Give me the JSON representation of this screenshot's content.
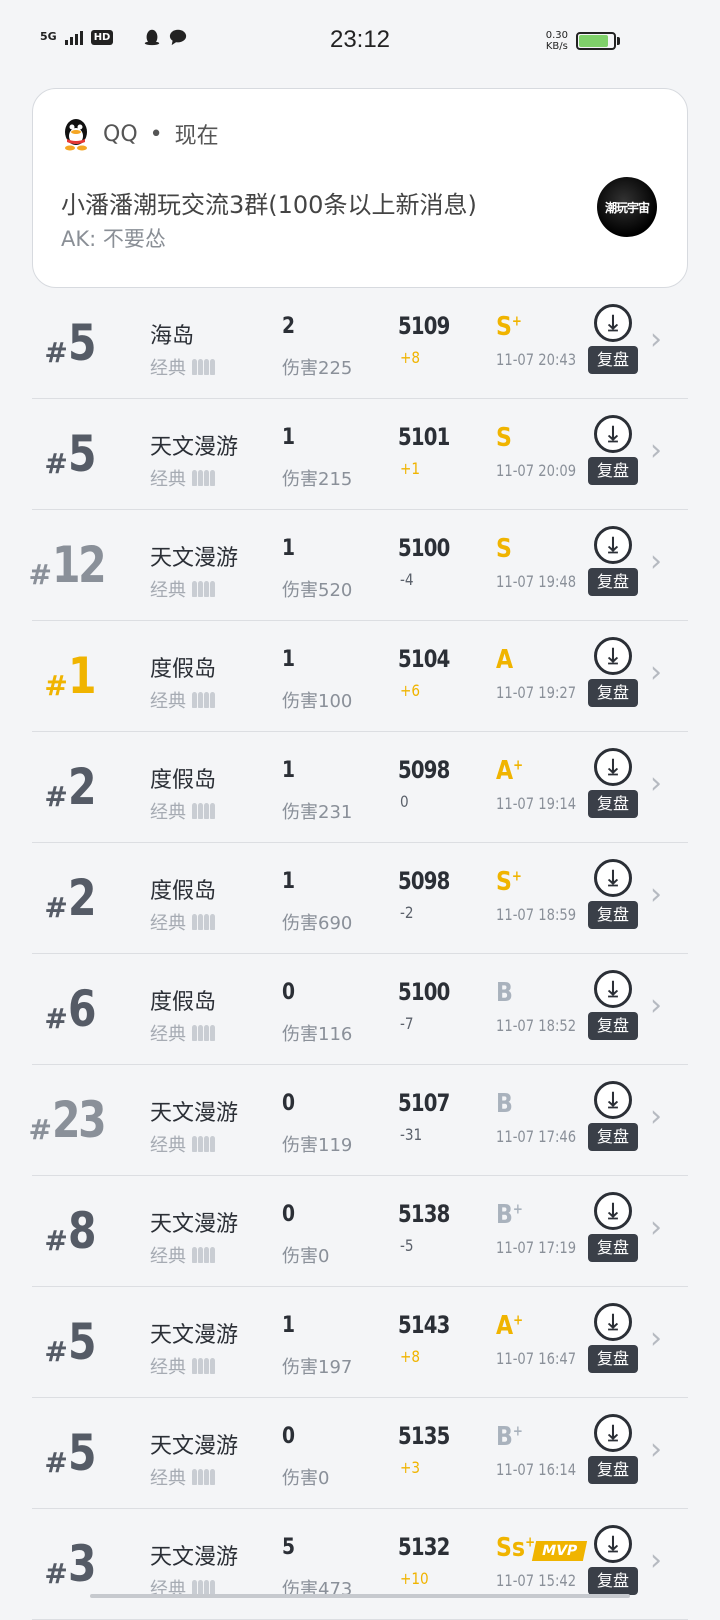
{
  "status_bar": {
    "network": "5G",
    "hd": "HD",
    "time": "23:12",
    "speed_value": "0.30",
    "speed_unit": "KB/s",
    "battery_percent": 85
  },
  "notification": {
    "app_name": "QQ",
    "separator": "•",
    "when": "现在",
    "title": "小潘潘潮玩交流3群(100条以上新消息)",
    "message": "AK: 不要怂",
    "avatar_text": "潮玩宇宙"
  },
  "colors": {
    "gold": "#f0b400",
    "dark": "#2b2f36",
    "gray": "#a9b2bd"
  },
  "replay_label": "复盘",
  "matches": [
    {
      "rank_hash": "#",
      "rank": "5",
      "rank_style": "normal",
      "map": "海岛",
      "mode": "经典",
      "kills": "2",
      "damage": "伤害225",
      "score": "5109",
      "delta": "+8",
      "delta_style": "pos",
      "grade": "S",
      "grade_sup": "+",
      "grade_style": "gold",
      "date": "11-07 20:43",
      "mvp": ""
    },
    {
      "rank_hash": "#",
      "rank": "5",
      "rank_style": "normal",
      "map": "天文漫游",
      "mode": "经典",
      "kills": "1",
      "damage": "伤害215",
      "score": "5101",
      "delta": "+1",
      "delta_style": "pos",
      "grade": "S",
      "grade_sup": "",
      "grade_style": "gold",
      "date": "11-07 20:09",
      "mvp": ""
    },
    {
      "rank_hash": "#",
      "rank": "12",
      "rank_style": "light",
      "map": "天文漫游",
      "mode": "经典",
      "kills": "1",
      "damage": "伤害520",
      "score": "5100",
      "delta": "-4",
      "delta_style": "neg",
      "grade": "S",
      "grade_sup": "",
      "grade_style": "gold",
      "date": "11-07 19:48",
      "mvp": ""
    },
    {
      "rank_hash": "#",
      "rank": "1",
      "rank_style": "gold",
      "map": "度假岛",
      "mode": "经典",
      "kills": "1",
      "damage": "伤害100",
      "score": "5104",
      "delta": "+6",
      "delta_style": "pos",
      "grade": "A",
      "grade_sup": "",
      "grade_style": "gold",
      "date": "11-07 19:27",
      "mvp": ""
    },
    {
      "rank_hash": "#",
      "rank": "2",
      "rank_style": "normal",
      "map": "度假岛",
      "mode": "经典",
      "kills": "1",
      "damage": "伤害231",
      "score": "5098",
      "delta": "0",
      "delta_style": "neg",
      "grade": "A",
      "grade_sup": "+",
      "grade_style": "gold",
      "date": "11-07 19:14",
      "mvp": ""
    },
    {
      "rank_hash": "#",
      "rank": "2",
      "rank_style": "normal",
      "map": "度假岛",
      "mode": "经典",
      "kills": "1",
      "damage": "伤害690",
      "score": "5098",
      "delta": "-2",
      "delta_style": "neg",
      "grade": "S",
      "grade_sup": "+",
      "grade_style": "gold",
      "date": "11-07 18:59",
      "mvp": ""
    },
    {
      "rank_hash": "#",
      "rank": "6",
      "rank_style": "normal",
      "map": "度假岛",
      "mode": "经典",
      "kills": "0",
      "damage": "伤害116",
      "score": "5100",
      "delta": "-7",
      "delta_style": "neg",
      "grade": "B",
      "grade_sup": "",
      "grade_style": "gray",
      "date": "11-07 18:52",
      "mvp": ""
    },
    {
      "rank_hash": "#",
      "rank": "23",
      "rank_style": "light",
      "map": "天文漫游",
      "mode": "经典",
      "kills": "0",
      "damage": "伤害119",
      "score": "5107",
      "delta": "-31",
      "delta_style": "neg",
      "grade": "B",
      "grade_sup": "",
      "grade_style": "gray",
      "date": "11-07 17:46",
      "mvp": ""
    },
    {
      "rank_hash": "#",
      "rank": "8",
      "rank_style": "normal",
      "map": "天文漫游",
      "mode": "经典",
      "kills": "0",
      "damage": "伤害0",
      "score": "5138",
      "delta": "-5",
      "delta_style": "neg",
      "grade": "B",
      "grade_sup": "+",
      "grade_style": "gray",
      "date": "11-07 17:19",
      "mvp": ""
    },
    {
      "rank_hash": "#",
      "rank": "5",
      "rank_style": "normal",
      "map": "天文漫游",
      "mode": "经典",
      "kills": "1",
      "damage": "伤害197",
      "score": "5143",
      "delta": "+8",
      "delta_style": "pos",
      "grade": "A",
      "grade_sup": "+",
      "grade_style": "gold",
      "date": "11-07 16:47",
      "mvp": ""
    },
    {
      "rank_hash": "#",
      "rank": "5",
      "rank_style": "normal",
      "map": "天文漫游",
      "mode": "经典",
      "kills": "0",
      "damage": "伤害0",
      "score": "5135",
      "delta": "+3",
      "delta_style": "pos",
      "grade": "B",
      "grade_sup": "+",
      "grade_style": "gray",
      "date": "11-07 16:14",
      "mvp": ""
    },
    {
      "rank_hash": "#",
      "rank": "3",
      "rank_style": "normal",
      "map": "天文漫游",
      "mode": "经典",
      "kills": "5",
      "damage": "伤害473",
      "score": "5132",
      "delta": "+10",
      "delta_style": "pos",
      "grade": "Ss",
      "grade_sup": "+",
      "grade_style": "gold",
      "date": "11-07 15:42",
      "mvp": "MVP"
    }
  ]
}
